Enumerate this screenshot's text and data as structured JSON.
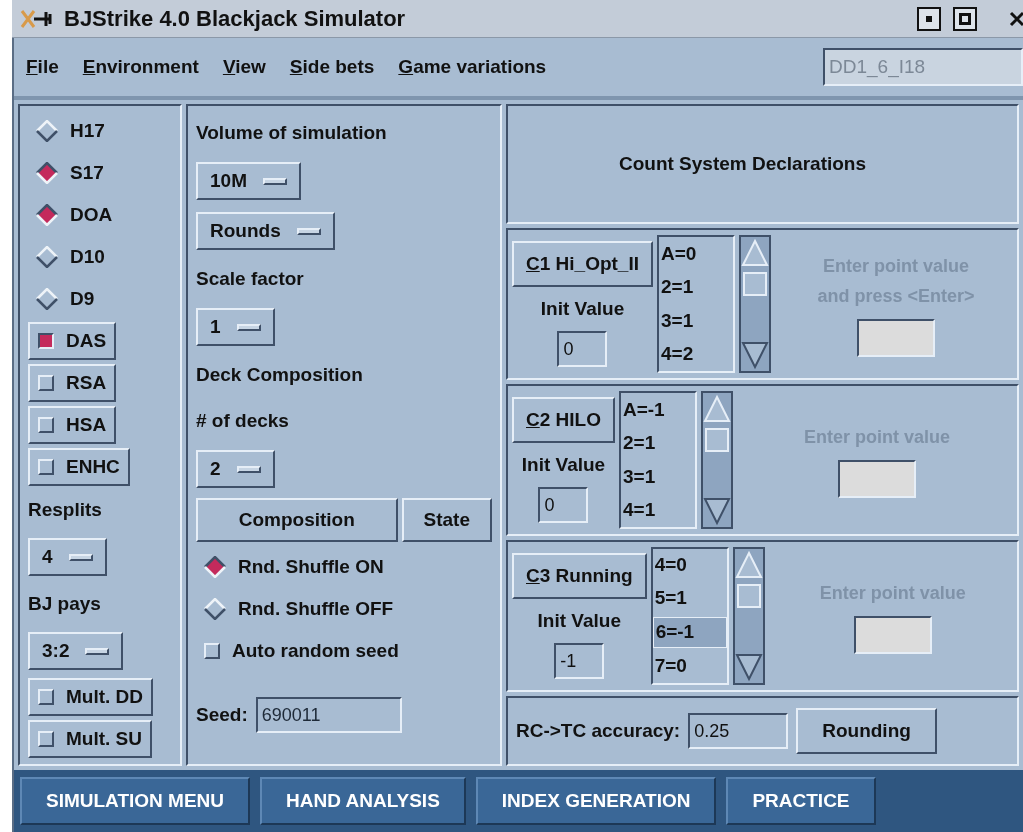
{
  "window": {
    "title": "BJStrike 4.0 Blackjack Simulator"
  },
  "menu": [
    {
      "label": "File",
      "mnemonic": true
    },
    {
      "label": "Environment",
      "mnemonic": true
    },
    {
      "label": "View",
      "mnemonic": true
    },
    {
      "label": "Side bets",
      "mnemonic": true
    },
    {
      "label": "Game variations",
      "mnemonic": true
    }
  ],
  "profile_field": {
    "value": "DD1_6_I18"
  },
  "rules": [
    {
      "kind": "radio",
      "label": "H17",
      "selected": false
    },
    {
      "kind": "radio",
      "label": "S17",
      "selected": true
    },
    {
      "kind": "radio",
      "label": "DOA",
      "selected": true
    },
    {
      "kind": "radio",
      "label": "D10",
      "selected": false
    },
    {
      "kind": "radio",
      "label": "D9",
      "selected": false
    },
    {
      "kind": "checkbox",
      "label": "DAS",
      "checked": true
    },
    {
      "kind": "checkbox",
      "label": "RSA",
      "checked": false
    },
    {
      "kind": "checkbox",
      "label": "HSA",
      "checked": false
    },
    {
      "kind": "checkbox",
      "label": "ENHC",
      "checked": false
    },
    {
      "kind": "label",
      "label": "Resplits"
    },
    {
      "kind": "dropdown",
      "value": "4"
    },
    {
      "kind": "label",
      "label": "BJ pays"
    },
    {
      "kind": "dropdown",
      "value": "3:2"
    },
    {
      "kind": "checkbox",
      "label": "Mult. DD",
      "checked": false
    },
    {
      "kind": "checkbox",
      "label": "Mult. SU",
      "checked": false
    }
  ],
  "simulation": [
    {
      "kind": "label",
      "label": "Volume of simulation"
    },
    {
      "kind": "dropdown",
      "value": "10M"
    },
    {
      "kind": "dropdown",
      "value": "Rounds"
    },
    {
      "kind": "label",
      "label": "Scale factor"
    },
    {
      "kind": "dropdown",
      "value": "1"
    },
    {
      "kind": "label",
      "label": "Deck Composition"
    },
    {
      "kind": "label",
      "label": "# of decks"
    },
    {
      "kind": "dropdown",
      "value": "2"
    },
    {
      "kind": "buttons",
      "buttons": [
        "Composition",
        "State"
      ]
    },
    {
      "kind": "radio",
      "label": "Rnd. Shuffle ON",
      "selected": true
    },
    {
      "kind": "radio",
      "label": "Rnd. Shuffle OFF",
      "selected": false
    },
    {
      "kind": "checkbox",
      "label": "Auto random seed",
      "checked": false
    },
    {
      "kind": "field",
      "label": "Seed:",
      "value": "690011"
    }
  ],
  "count_systems": {
    "title": "Count System Declarations",
    "counts": [
      {
        "button": "C1 Hi_Opt_II",
        "mnemonic": true,
        "init_label": "Init Value",
        "init_value": "0",
        "values": [
          {
            "text": "A=0",
            "selected": false
          },
          {
            "text": "2=1",
            "selected": false
          },
          {
            "text": "3=1",
            "selected": false
          },
          {
            "text": "4=2",
            "selected": false
          }
        ],
        "hint": [
          "Enter point value",
          "and press <Enter>"
        ]
      },
      {
        "button": "C2 HILO",
        "mnemonic": true,
        "init_label": "Init Value",
        "init_value": "0",
        "values": [
          {
            "text": "A=-1",
            "selected": false
          },
          {
            "text": "2=1",
            "selected": false
          },
          {
            "text": "3=1",
            "selected": false
          },
          {
            "text": "4=1",
            "selected": false
          }
        ],
        "hint": [
          "Enter point value"
        ]
      },
      {
        "button": "C3 Running",
        "mnemonic": true,
        "init_label": "Init Value",
        "init_value": "-1",
        "values": [
          {
            "text": "4=0",
            "selected": false
          },
          {
            "text": "5=1",
            "selected": false
          },
          {
            "text": "6=-1",
            "selected": true
          },
          {
            "text": "7=0",
            "selected": false
          }
        ],
        "hint": [
          "Enter point value"
        ]
      }
    ],
    "accuracy": {
      "label": "RC->TC accuracy:",
      "value": "0.25",
      "button": "Rounding"
    }
  },
  "bottom_tabs": [
    "SIMULATION MENU",
    "HAND ANALYSIS",
    "INDEX GENERATION",
    "PRACTICE"
  ]
}
